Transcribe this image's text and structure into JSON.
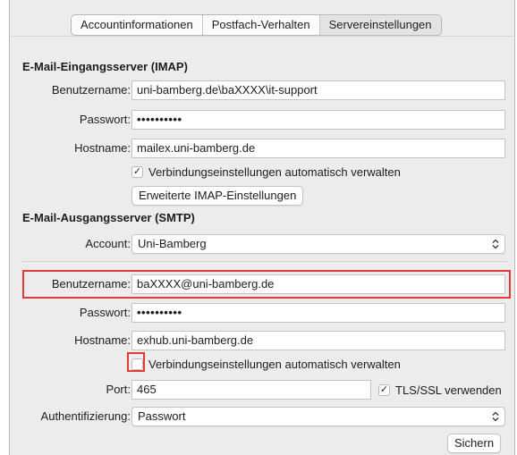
{
  "tabs": [
    {
      "label": "Accountinformationen",
      "active": false
    },
    {
      "label": "Postfach-Verhalten",
      "active": false
    },
    {
      "label": "Servereinstellungen",
      "active": true
    }
  ],
  "imap": {
    "title": "E-Mail-Eingangsserver (IMAP)",
    "username_label": "Benutzername:",
    "username_value": "uni-bamberg.de\\baXXXX\\it-support",
    "password_label": "Passwort:",
    "password_value": "••••••••••",
    "hostname_label": "Hostname:",
    "hostname_value": "mailex.uni-bamberg.de",
    "auto_manage_label": "Verbindungseinstellungen automatisch verwalten",
    "auto_manage_checked": true,
    "advanced_button": "Erweiterte IMAP-Einstellungen"
  },
  "smtp": {
    "title": "E-Mail-Ausgangsserver (SMTP)",
    "account_label": "Account:",
    "account_value": "Uni-Bamberg",
    "username_label": "Benutzername:",
    "username_value": "baXXXX@uni-bamberg.de",
    "password_label": "Passwort:",
    "password_value": "••••••••••",
    "hostname_label": "Hostname:",
    "hostname_value": "exhub.uni-bamberg.de",
    "auto_manage_label": "Verbindungseinstellungen automatisch verwalten",
    "auto_manage_checked": false,
    "port_label": "Port:",
    "port_value": "465",
    "tls_label": "TLS/SSL verwenden",
    "tls_checked": true,
    "auth_label": "Authentifizierung:",
    "auth_value": "Passwort"
  },
  "save_button": "Sichern",
  "icons": {
    "checkmark": "✓",
    "select_arrows": "⌃⌄"
  },
  "colors": {
    "highlight": "#e03a3a",
    "window_bg": "#ececec"
  }
}
